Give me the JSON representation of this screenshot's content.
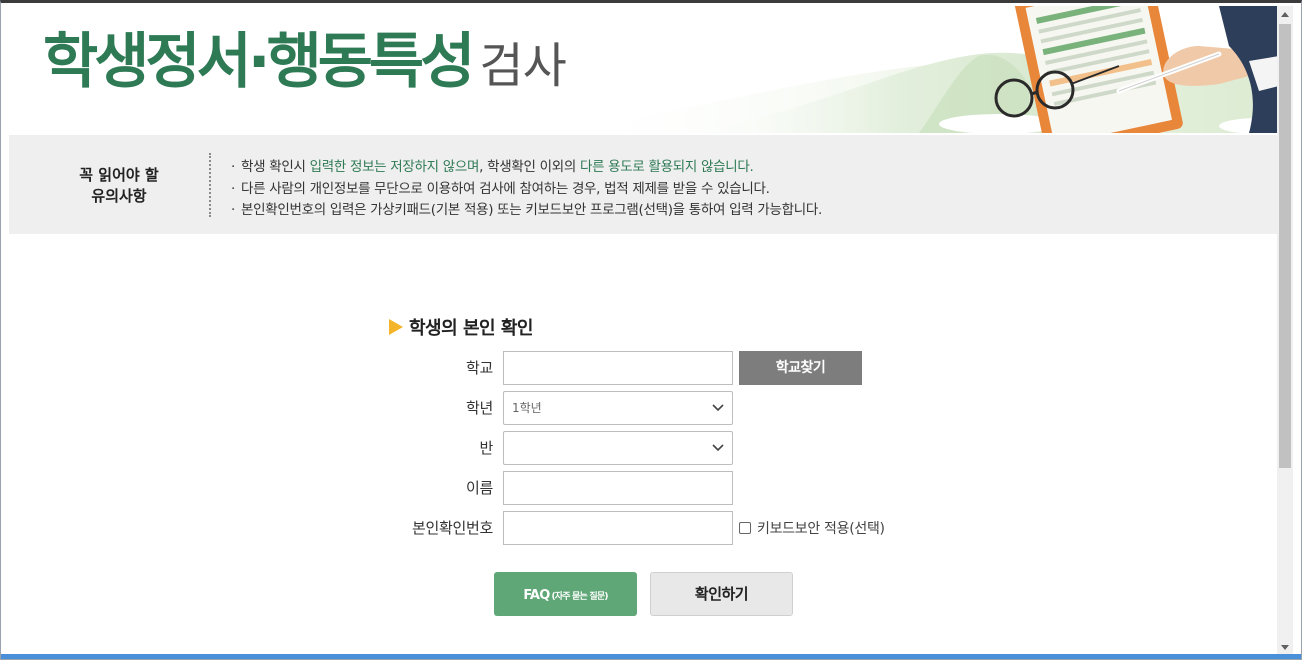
{
  "header": {
    "title_main": "학생정서·행동특성",
    "title_sub": "검사"
  },
  "notice": {
    "title_line1": "꼭 읽어야 할",
    "title_line2": "유의사항",
    "items": [
      {
        "bullet": "·",
        "pre": "학생 확인시 ",
        "hl1": "입력한 정보는 저장하지 않으며",
        "mid": ", 학생확인 이외의 ",
        "hl2": "다른 용도로 활용되지 않습니다."
      },
      {
        "bullet": "·",
        "text": "다른 사람의 개인정보를 무단으로 이용하여 검사에 참여하는 경우, 법적 제제를 받을 수 있습니다."
      },
      {
        "bullet": "·",
        "text": "본인확인번호의 입력은 가상키패드(기본 적용) 또는 키보드보안 프로그램(선택)을 통하여 입력 가능합니다."
      }
    ]
  },
  "form": {
    "heading": "학생의 본인 확인",
    "school_label": "학교",
    "school_value": "",
    "school_search_button": "학교찾기",
    "grade_label": "학년",
    "grade_selected": "1학년",
    "class_label": "반",
    "class_selected": "",
    "name_label": "이름",
    "name_value": "",
    "id_label": "본인확인번호",
    "id_value": "",
    "keyboard_security_label": "키보드보안 적용(선택)"
  },
  "buttons": {
    "faq_main": "FAQ",
    "faq_sub": "(자주 묻는 질문)",
    "confirm": "확인하기"
  },
  "colors": {
    "brand_green": "#2e7a55",
    "faq_green": "#5fa777",
    "accent_yellow": "#f5b52a",
    "search_button_gray": "#7d7d7d"
  }
}
